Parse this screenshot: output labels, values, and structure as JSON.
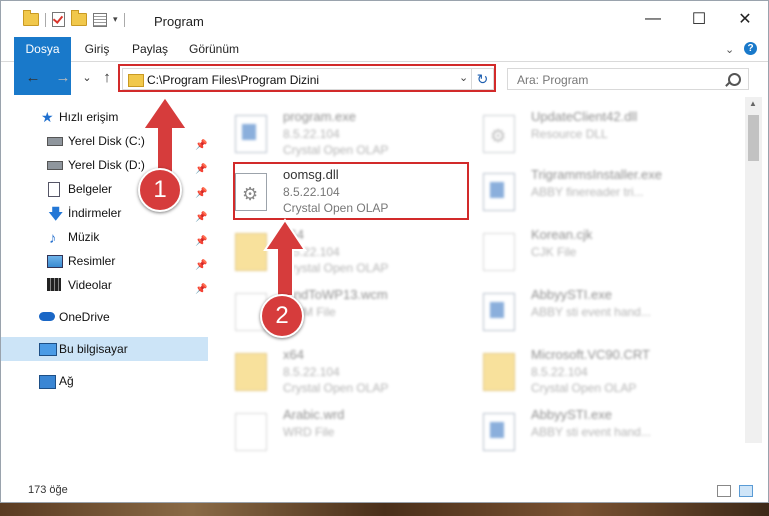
{
  "window": {
    "title": "Program",
    "controls": {
      "minimize": "—",
      "maximize": "☐",
      "close": "✕"
    }
  },
  "ribbon": {
    "tabs": [
      "Dosya",
      "Giriş",
      "Paylaş",
      "Görünüm"
    ],
    "help": "?"
  },
  "nav": {
    "back": "←",
    "forward": "→",
    "recent": "⌄",
    "up": "↑",
    "address": "C:\\Program Files\\Program Dizini",
    "dropdown": "⌄",
    "refresh": "↻",
    "search_placeholder": "Ara: Program"
  },
  "sidebar": {
    "quick_access": "Hızlı erişim",
    "items": [
      "Yerel Disk (C:)",
      "Yerel Disk (D:)",
      "Belgeler",
      "İndirmeler",
      "Müzik",
      "Resimler",
      "Videolar"
    ],
    "onedrive": "OneDrive",
    "this_pc": "Bu bilgisayar",
    "network": "Ağ"
  },
  "files": [
    {
      "name": "program.exe",
      "line1": "8.5.22.104",
      "line2": "Crystal Open OLAP",
      "icon": "exe-icon"
    },
    {
      "name": "UpdateClient42.dll",
      "line1": "Resource DLL",
      "line2": "",
      "icon": "dll-icon"
    },
    {
      "name": "oomsg.dll",
      "line1": "8.5.22.104",
      "line2": "Crystal Open OLAP",
      "icon": "dll-icon"
    },
    {
      "name": "TrigrammsInstaller.exe",
      "line1": "ABBY finereader tri...",
      "line2": "",
      "icon": "exe-icon"
    },
    {
      "name": "x64",
      "line1": "8.5.22.104",
      "line2": "Crystal Open OLAP",
      "icon": "folder-icon"
    },
    {
      "name": "Korean.cjk",
      "line1": "CJK File",
      "line2": "",
      "icon": "file-icon"
    },
    {
      "name": "FindToWP13.wcm",
      "line1": "WCM File",
      "line2": "",
      "icon": "file-icon"
    },
    {
      "name": "AbbyySTI.exe",
      "line1": "ABBY sti event hand...",
      "line2": "",
      "icon": "exe-icon"
    },
    {
      "name": "x64",
      "line1": "8.5.22.104",
      "line2": "Crystal Open OLAP",
      "icon": "folder-icon"
    },
    {
      "name": "Microsoft.VC90.CRT",
      "line1": "8.5.22.104",
      "line2": "Crystal Open OLAP",
      "icon": "folder-icon"
    },
    {
      "name": "Arabic.wrd",
      "line1": "WRD File",
      "line2": "",
      "icon": "file-icon"
    },
    {
      "name": "AbbyySTI.exe",
      "line1": "ABBY sti event hand...",
      "line2": "",
      "icon": "exe-icon"
    }
  ],
  "status": {
    "count": "173 öğe"
  },
  "callouts": {
    "step1": "1",
    "step2": "2"
  },
  "colors": {
    "accent": "#1979ca",
    "highlight": "#d22a2a",
    "selected": "#cce4f7"
  }
}
